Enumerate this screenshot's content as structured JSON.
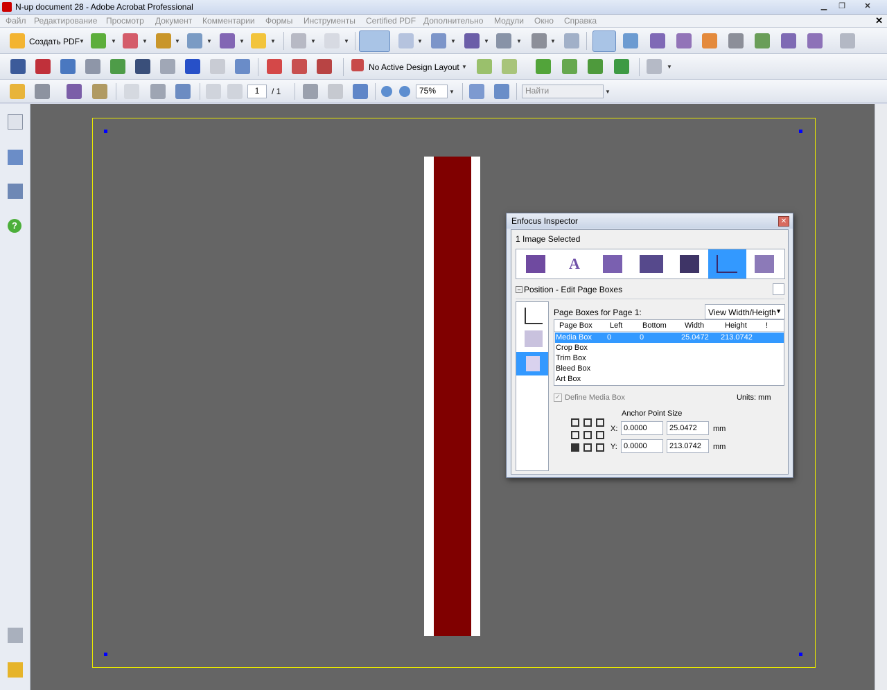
{
  "window": {
    "title": "N-up document 28 - Adobe Acrobat Professional"
  },
  "menu": [
    "Файл",
    "Редактирование",
    "Просмотр",
    "Документ",
    "Комментарии",
    "Формы",
    "Инструменты",
    "Certified PDF",
    "Дополнительно",
    "Модули",
    "Окно",
    "Справка"
  ],
  "toolbar1": {
    "create_pdf_label": "Создать PDF"
  },
  "toolbar2": {
    "design_layout_label": "No Active Design Layout"
  },
  "toolbar3": {
    "page_current": "1",
    "page_total": "/ 1",
    "zoom": "75%",
    "search_placeholder": "Найти"
  },
  "inspector": {
    "title": "Enfocus Inspector",
    "selection": "1 Image Selected",
    "section_title": "Position - Edit Page Boxes",
    "boxes_label": "Page Boxes for Page 1:",
    "view_dropdown": "View Width/Heigth",
    "columns": [
      "Page Box",
      "Left",
      "Bottom",
      "Width",
      "Height",
      "!"
    ],
    "rows": [
      {
        "name": "Media Box",
        "left": "0",
        "bottom": "0",
        "width": "25.0472",
        "height": "213.0742"
      },
      {
        "name": "Crop Box",
        "left": "",
        "bottom": "",
        "width": "",
        "height": ""
      },
      {
        "name": "Trim Box",
        "left": "",
        "bottom": "",
        "width": "",
        "height": ""
      },
      {
        "name": "Bleed Box",
        "left": "",
        "bottom": "",
        "width": "",
        "height": ""
      },
      {
        "name": "Art Box",
        "left": "",
        "bottom": "",
        "width": "",
        "height": ""
      }
    ],
    "define_media_box": "Define Media Box",
    "units": "Units: mm",
    "anchor_label": "Anchor Point",
    "size_label": "Size",
    "x_label": "X:",
    "y_label": "Y:",
    "x_anchor": "0.0000",
    "y_anchor": "0.0000",
    "width": "25.0472",
    "height": "213.0742",
    "unit": "mm"
  },
  "colors": {
    "page_strip": "#800000",
    "selection": "#3399ff",
    "frame": "#e8e800"
  }
}
